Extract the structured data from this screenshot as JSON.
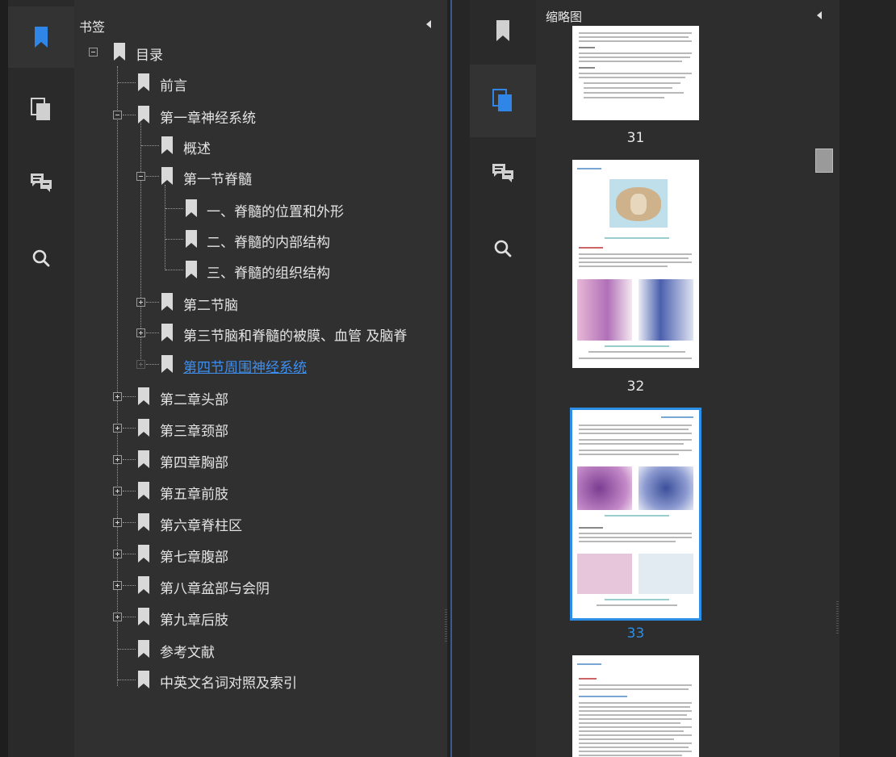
{
  "bookmarks_panel": {
    "title": "书签",
    "items": [
      {
        "label": "目录"
      },
      {
        "label": "前言"
      },
      {
        "label": "第一章神经系统"
      },
      {
        "label": "概述"
      },
      {
        "label": "第一节脊髓"
      },
      {
        "label": "一、脊髓的位置和外形"
      },
      {
        "label": "二、脊髓的内部结构"
      },
      {
        "label": "三、脊髓的组织结构"
      },
      {
        "label": "第二节脑"
      },
      {
        "label": "第三节脑和脊髓的被膜、血管 及脑脊"
      },
      {
        "label": "第四节周围神经系统"
      },
      {
        "label": "第二章头部"
      },
      {
        "label": "第三章颈部"
      },
      {
        "label": "第四章胸部"
      },
      {
        "label": "第五章前肢"
      },
      {
        "label": "第六章脊柱区"
      },
      {
        "label": "第七章腹部"
      },
      {
        "label": "第八章盆部与会阴"
      },
      {
        "label": "第九章后肢"
      },
      {
        "label": "参考文献"
      },
      {
        "label": "中英文名词对照及索引"
      }
    ]
  },
  "thumbnails_panel": {
    "title": "缩略图",
    "pages": [
      {
        "number": "31"
      },
      {
        "number": "32"
      },
      {
        "number": "33"
      }
    ]
  },
  "sidebar_icons": [
    "bookmark-icon",
    "pages-icon",
    "comments-icon",
    "search-icon"
  ],
  "colors": {
    "accent": "#2d8ee6",
    "link": "#3d8ff0",
    "panel": "#303030"
  }
}
